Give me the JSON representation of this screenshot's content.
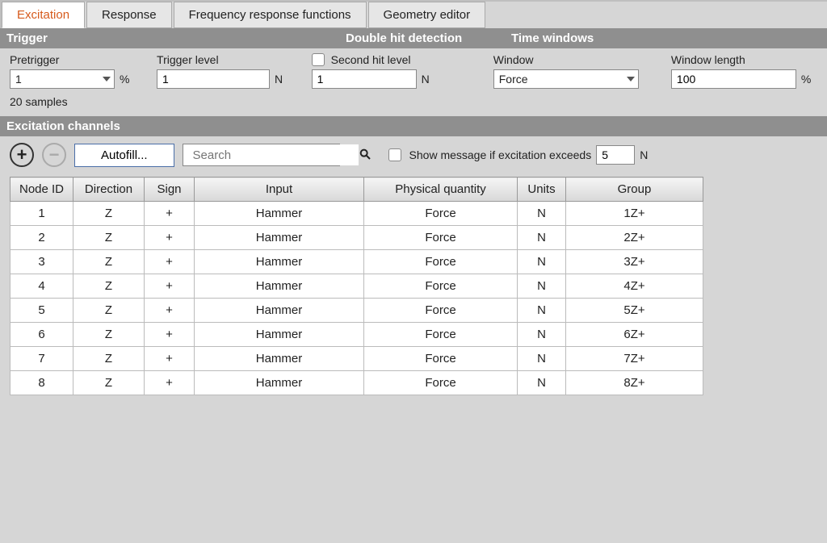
{
  "tabs": {
    "excitation": "Excitation",
    "response": "Response",
    "frf": "Frequency response functions",
    "geometry": "Geometry editor"
  },
  "band1": {
    "trigger": "Trigger",
    "double_hit": "Double hit detection",
    "time_windows": "Time windows"
  },
  "trigger": {
    "pretrigger_label": "Pretrigger",
    "pretrigger_value": "1",
    "pretrigger_unit": "%",
    "pretrigger_sub": "20 samples",
    "trigger_level_label": "Trigger level",
    "trigger_level_value": "1",
    "trigger_level_unit": "N",
    "second_hit_label": "Second hit level",
    "second_hit_value": "1",
    "second_hit_unit": "N",
    "window_label": "Window",
    "window_value": "Force",
    "window_length_label": "Window length",
    "window_length_value": "100",
    "window_length_unit": "%"
  },
  "band2": {
    "title": "Excitation channels"
  },
  "toolbar": {
    "autofill": "Autofill...",
    "search_placeholder": "Search",
    "show_message": "Show message if excitation exceeds",
    "show_message_value": "5",
    "show_message_unit": "N"
  },
  "table": {
    "headers": {
      "node_id": "Node ID",
      "direction": "Direction",
      "sign": "Sign",
      "input": "Input",
      "pq": "Physical quantity",
      "units": "Units",
      "group": "Group"
    },
    "rows": [
      {
        "node": "1",
        "dir": "Z",
        "sign": "+",
        "input": "Hammer",
        "pq": "Force",
        "units": "N",
        "group": "1Z+"
      },
      {
        "node": "2",
        "dir": "Z",
        "sign": "+",
        "input": "Hammer",
        "pq": "Force",
        "units": "N",
        "group": "2Z+"
      },
      {
        "node": "3",
        "dir": "Z",
        "sign": "+",
        "input": "Hammer",
        "pq": "Force",
        "units": "N",
        "group": "3Z+"
      },
      {
        "node": "4",
        "dir": "Z",
        "sign": "+",
        "input": "Hammer",
        "pq": "Force",
        "units": "N",
        "group": "4Z+"
      },
      {
        "node": "5",
        "dir": "Z",
        "sign": "+",
        "input": "Hammer",
        "pq": "Force",
        "units": "N",
        "group": "5Z+"
      },
      {
        "node": "6",
        "dir": "Z",
        "sign": "+",
        "input": "Hammer",
        "pq": "Force",
        "units": "N",
        "group": "6Z+"
      },
      {
        "node": "7",
        "dir": "Z",
        "sign": "+",
        "input": "Hammer",
        "pq": "Force",
        "units": "N",
        "group": "7Z+"
      },
      {
        "node": "8",
        "dir": "Z",
        "sign": "+",
        "input": "Hammer",
        "pq": "Force",
        "units": "N",
        "group": "8Z+"
      }
    ]
  }
}
